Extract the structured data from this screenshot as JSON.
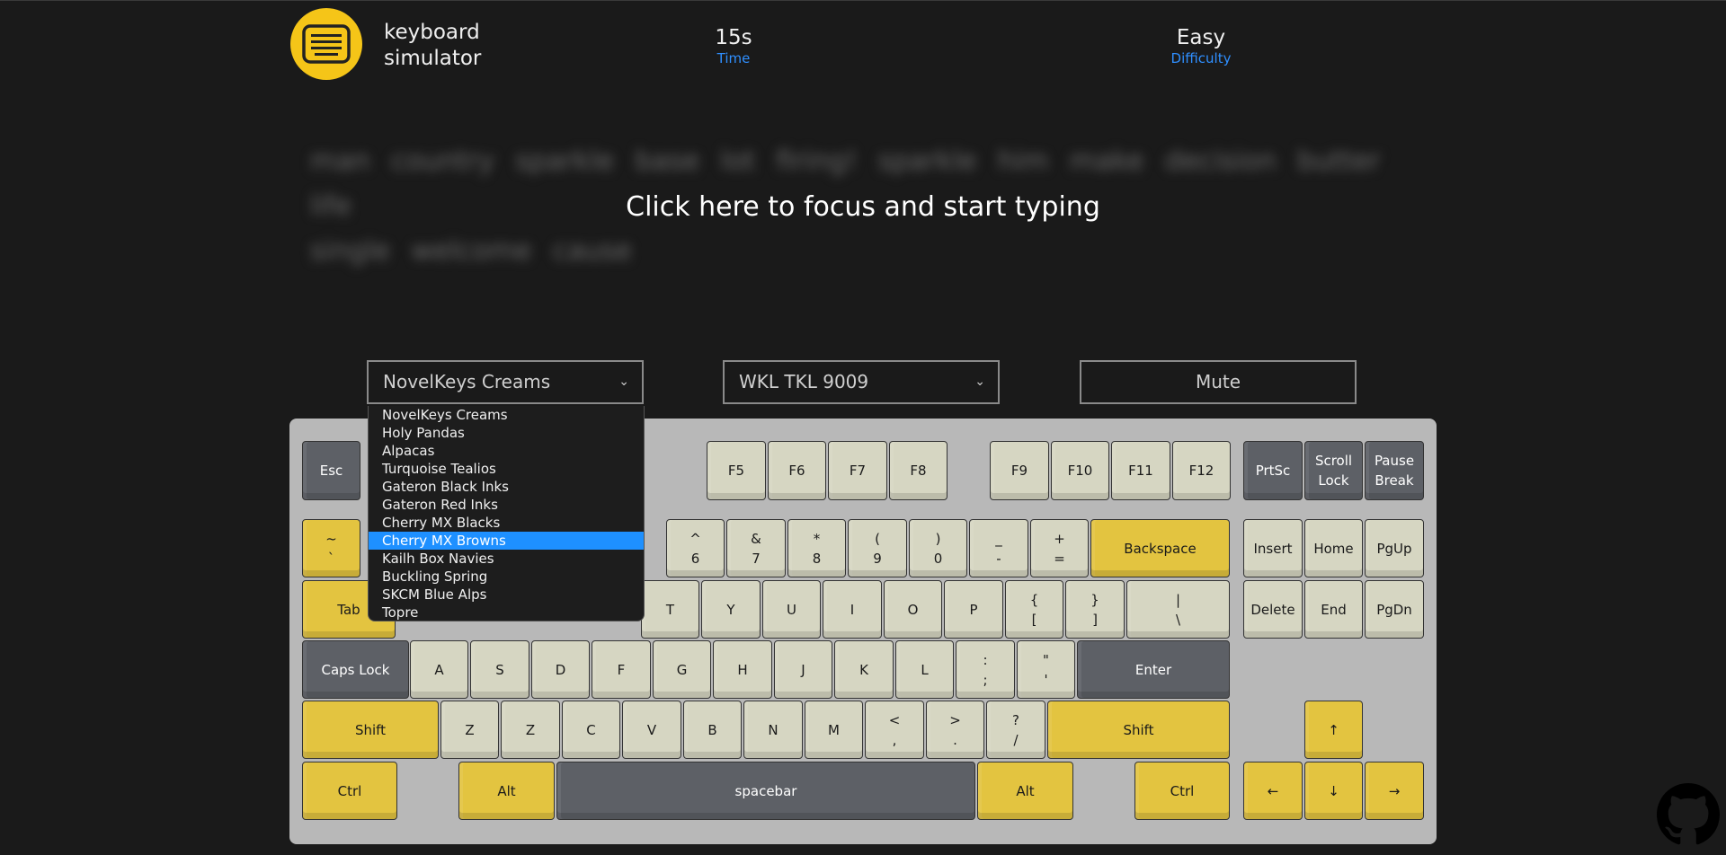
{
  "header": {
    "brand_line1": "keyboard",
    "brand_line2": "simulator",
    "time_value": "15s",
    "time_label": "Time",
    "difficulty_value": "Easy",
    "difficulty_label": "Difficulty"
  },
  "typing": {
    "line1": "man country sparkle base lot firing! sparkle him make decision butter life",
    "line2": "single welcome cause",
    "focus_message": "Click here to focus and start typing"
  },
  "controls": {
    "switch_selected": "NovelKeys Creams",
    "keyboard_selected": "WKL TKL 9009",
    "mute_label": "Mute"
  },
  "dropdown": {
    "options": [
      "NovelKeys Creams",
      "Holy Pandas",
      "Alpacas",
      "Turquoise Tealios",
      "Gateron Black Inks",
      "Gateron Red Inks",
      "Cherry MX Blacks",
      "Cherry MX Browns",
      "Kailh Box Navies",
      "Buckling Spring",
      "SKCM Blue Alps",
      "Topre"
    ],
    "highlighted_index": 7
  },
  "keyboard": {
    "keys": [
      {
        "top": "Esc",
        "color": "gray"
      },
      {
        "top": "F5",
        "color": "cream"
      },
      {
        "top": "F6",
        "color": "cream"
      },
      {
        "top": "F7",
        "color": "cream"
      },
      {
        "top": "F8",
        "color": "cream"
      },
      {
        "top": "F9",
        "color": "cream"
      },
      {
        "top": "F10",
        "color": "cream"
      },
      {
        "top": "F11",
        "color": "cream"
      },
      {
        "top": "F12",
        "color": "cream"
      },
      {
        "top": "PrtSc",
        "color": "gray"
      },
      {
        "top": "Scroll",
        "bottom": "Lock",
        "color": "gray"
      },
      {
        "top": "Pause",
        "bottom": "Break",
        "color": "gray"
      },
      {
        "top": "~",
        "bottom": "`",
        "color": "yellow"
      },
      {
        "top": "^",
        "bottom": "6",
        "color": "cream"
      },
      {
        "top": "&",
        "bottom": "7",
        "color": "cream"
      },
      {
        "top": "*",
        "bottom": "8",
        "color": "cream"
      },
      {
        "top": "(",
        "bottom": "9",
        "color": "cream"
      },
      {
        "top": ")",
        "bottom": "0",
        "color": "cream"
      },
      {
        "top": "_",
        "bottom": "-",
        "color": "cream"
      },
      {
        "top": "+",
        "bottom": "=",
        "color": "cream"
      },
      {
        "top": "Backspace",
        "color": "yellow"
      },
      {
        "top": "Insert",
        "color": "cream"
      },
      {
        "top": "Home",
        "color": "cream"
      },
      {
        "top": "PgUp",
        "color": "cream"
      },
      {
        "top": "Tab",
        "color": "yellow"
      },
      {
        "top": "T",
        "color": "cream"
      },
      {
        "top": "Y",
        "color": "cream"
      },
      {
        "top": "U",
        "color": "cream"
      },
      {
        "top": "I",
        "color": "cream"
      },
      {
        "top": "O",
        "color": "cream"
      },
      {
        "top": "P",
        "color": "cream"
      },
      {
        "top": "{",
        "bottom": "[",
        "color": "cream"
      },
      {
        "top": "}",
        "bottom": "]",
        "color": "cream"
      },
      {
        "top": "|",
        "bottom": "\\",
        "color": "cream"
      },
      {
        "top": "Delete",
        "color": "cream"
      },
      {
        "top": "End",
        "color": "cream"
      },
      {
        "top": "PgDn",
        "color": "cream"
      },
      {
        "top": "Caps Lock",
        "color": "gray"
      },
      {
        "top": "A",
        "color": "cream"
      },
      {
        "top": "S",
        "color": "cream"
      },
      {
        "top": "D",
        "color": "cream"
      },
      {
        "top": "F",
        "color": "cream"
      },
      {
        "top": "G",
        "color": "cream"
      },
      {
        "top": "H",
        "color": "cream"
      },
      {
        "top": "J",
        "color": "cream"
      },
      {
        "top": "K",
        "color": "cream"
      },
      {
        "top": "L",
        "color": "cream"
      },
      {
        "top": ":",
        "bottom": ";",
        "color": "cream"
      },
      {
        "top": "\"",
        "bottom": "'",
        "color": "cream"
      },
      {
        "top": "Enter",
        "color": "gray"
      },
      {
        "top": "Shift",
        "color": "yellow"
      },
      {
        "top": "Z",
        "color": "cream"
      },
      {
        "top": "Z",
        "color": "cream"
      },
      {
        "top": "C",
        "color": "cream"
      },
      {
        "top": "V",
        "color": "cream"
      },
      {
        "top": "B",
        "color": "cream"
      },
      {
        "top": "N",
        "color": "cream"
      },
      {
        "top": "M",
        "color": "cream"
      },
      {
        "top": "<",
        "bottom": ",",
        "color": "cream"
      },
      {
        "top": ">",
        "bottom": ".",
        "color": "cream"
      },
      {
        "top": "?",
        "bottom": "/",
        "color": "cream"
      },
      {
        "top": "Shift",
        "color": "yellow"
      },
      {
        "top": "↑",
        "color": "yellow"
      },
      {
        "top": "Ctrl",
        "color": "yellow"
      },
      {
        "top": "Alt",
        "color": "yellow"
      },
      {
        "top": "spacebar",
        "color": "gray"
      },
      {
        "top": "Alt",
        "color": "yellow"
      },
      {
        "top": "Ctrl",
        "color": "yellow"
      },
      {
        "top": "←",
        "color": "yellow"
      },
      {
        "top": "↓",
        "color": "yellow"
      },
      {
        "top": "→",
        "color": "yellow"
      }
    ]
  }
}
